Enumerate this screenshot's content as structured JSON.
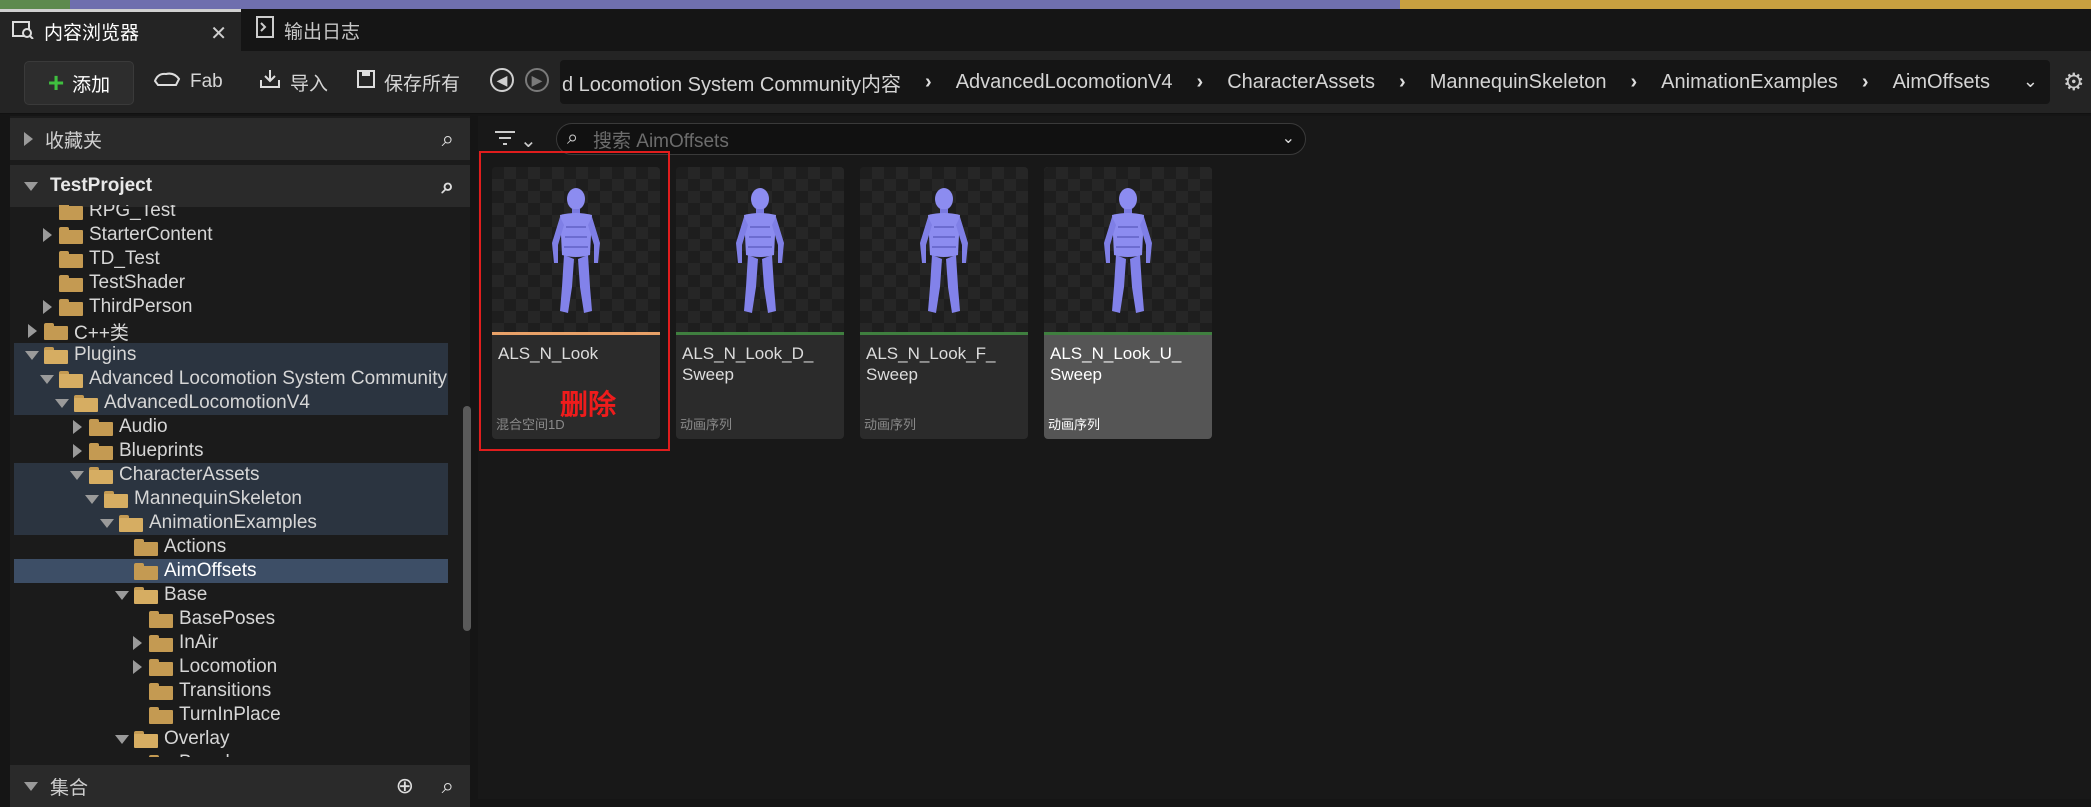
{
  "tabs": [
    {
      "label": "内容浏览器",
      "active": true,
      "icon": "content-browser-icon"
    },
    {
      "label": "输出日志",
      "active": false,
      "icon": "output-log-icon"
    }
  ],
  "toolbar": {
    "add_label": "添加",
    "fab_label": "Fab",
    "import_label": "导入",
    "save_all_label": "保存所有"
  },
  "breadcrumb": [
    "d Locomotion System Community内容",
    "AdvancedLocomotionV4",
    "CharacterAssets",
    "MannequinSkeleton",
    "AnimationExamples",
    "AimOffsets"
  ],
  "favorites": {
    "label": "收藏夹"
  },
  "project": {
    "label": "TestProject"
  },
  "tree": [
    {
      "label": "RPG_Test",
      "depth": 3,
      "expander": "none",
      "state": ""
    },
    {
      "label": "StarterContent",
      "depth": 3,
      "expander": "collapsed",
      "state": ""
    },
    {
      "label": "TD_Test",
      "depth": 3,
      "expander": "none",
      "state": ""
    },
    {
      "label": "TestShader",
      "depth": 3,
      "expander": "none",
      "state": ""
    },
    {
      "label": "ThirdPerson",
      "depth": 3,
      "expander": "collapsed",
      "state": ""
    },
    {
      "label": "C++类",
      "depth": 2,
      "expander": "collapsed",
      "state": "",
      "cpp": true
    },
    {
      "label": "Plugins",
      "depth": 2,
      "expander": "expanded",
      "state": "hl",
      "open": true
    },
    {
      "label": "Advanced Locomotion System Community",
      "depth": 3,
      "expander": "expanded",
      "state": "hl",
      "open": true
    },
    {
      "label": "AdvancedLocomotionV4",
      "depth": 4,
      "expander": "expanded",
      "state": "hl",
      "open": true
    },
    {
      "label": "Audio",
      "depth": 5,
      "expander": "collapsed",
      "state": ""
    },
    {
      "label": "Blueprints",
      "depth": 5,
      "expander": "collapsed",
      "state": ""
    },
    {
      "label": "CharacterAssets",
      "depth": 5,
      "expander": "expanded",
      "state": "hl",
      "open": true
    },
    {
      "label": "MannequinSkeleton",
      "depth": 6,
      "expander": "expanded",
      "state": "hl",
      "open": true
    },
    {
      "label": "AnimationExamples",
      "depth": 7,
      "expander": "expanded",
      "state": "hl",
      "open": true
    },
    {
      "label": "Actions",
      "depth": 8,
      "expander": "none",
      "state": ""
    },
    {
      "label": "AimOffsets",
      "depth": 8,
      "expander": "none",
      "state": "sel"
    },
    {
      "label": "Base",
      "depth": 8,
      "expander": "expanded",
      "state": "",
      "open": true
    },
    {
      "label": "BasePoses",
      "depth": 9,
      "expander": "none",
      "state": ""
    },
    {
      "label": "InAir",
      "depth": 9,
      "expander": "collapsed",
      "state": ""
    },
    {
      "label": "Locomotion",
      "depth": 9,
      "expander": "collapsed",
      "state": ""
    },
    {
      "label": "Transitions",
      "depth": 9,
      "expander": "none",
      "state": ""
    },
    {
      "label": "TurnInPlace",
      "depth": 9,
      "expander": "none",
      "state": ""
    },
    {
      "label": "Overlay",
      "depth": 8,
      "expander": "expanded",
      "state": "",
      "open": true
    },
    {
      "label": "Barrel",
      "depth": 9,
      "expander": "none",
      "state": ""
    }
  ],
  "collections": {
    "label": "集合"
  },
  "search": {
    "placeholder": "搜索 AimOffsets"
  },
  "assets": [
    {
      "name": "ALS_N_Look",
      "type": "混合空间1D",
      "kind": "blendspace"
    },
    {
      "name": "ALS_N_Look_D_ Sweep",
      "type": "动画序列",
      "kind": "sequence"
    },
    {
      "name": "ALS_N_Look_F_ Sweep",
      "type": "动画序列",
      "kind": "sequence"
    },
    {
      "name": "ALS_N_Look_U_ Sweep",
      "type": "动画序列",
      "kind": "sequence",
      "hovered": true
    }
  ],
  "annotation": {
    "label": "删除",
    "color": "#e01d1d"
  },
  "colors": {
    "accent_add": "#3fbf3f",
    "selection": "#3d4e66",
    "folder": "#c49a52",
    "mannequin": "#8c8cf0"
  }
}
